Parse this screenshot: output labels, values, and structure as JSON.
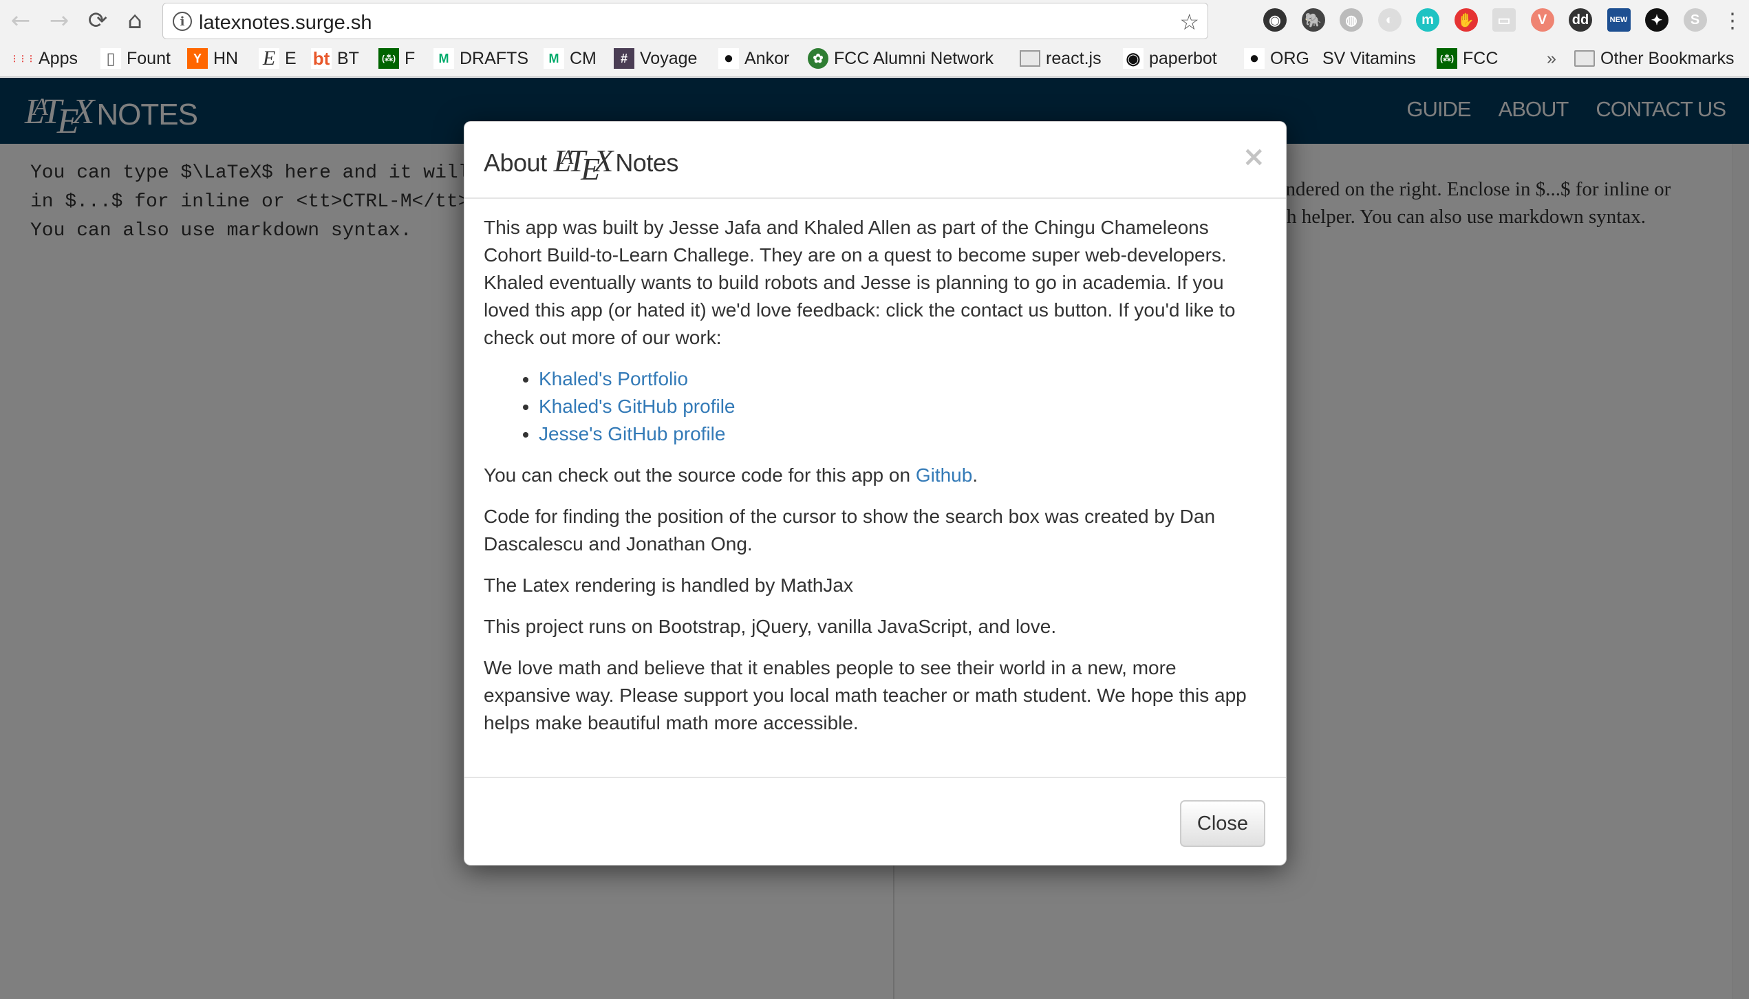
{
  "browser": {
    "nav": {
      "back_icon": "←",
      "forward_icon": "→",
      "reload_icon": "⟳",
      "home_icon": "⌂"
    },
    "address_bar": {
      "url": "latexnotes.surge.sh",
      "info_icon": "i",
      "bookmark_star_icon": "☆"
    },
    "extensions": [
      {
        "name": "camera-extension",
        "glyph": "◉",
        "color": "#333333"
      },
      {
        "name": "evernote-extension",
        "glyph": "🐘",
        "color": "#444444"
      },
      {
        "name": "globe-extension",
        "glyph": "◍",
        "color": "#bbbbbb"
      },
      {
        "name": "json-viewer-extension",
        "glyph": "◐",
        "color": "#dddddd"
      },
      {
        "name": "mercury-extension",
        "glyph": "m",
        "color": "#1ec3c3"
      },
      {
        "name": "adblock-extension",
        "glyph": "✋",
        "color": "#e53333"
      },
      {
        "name": "discover-devtools-extension",
        "glyph": "▭",
        "color": "#dddddd"
      },
      {
        "name": "vivaldi-extension",
        "glyph": "V",
        "color": "#ef8472"
      },
      {
        "name": "dd-extension",
        "glyph": "dd",
        "color": "#333333"
      },
      {
        "name": "news-extension",
        "glyph": "NEW",
        "color": "#1d4f91"
      },
      {
        "name": "ninja-extension",
        "glyph": "✦",
        "color": "#111111"
      },
      {
        "name": "skype-extension",
        "glyph": "S",
        "color": "#cccccc"
      }
    ],
    "menu_icon": "⋮",
    "bookmarks": [
      {
        "label": "Apps",
        "icon": "apps-grid-icon",
        "glyph": "⋮⋮⋮",
        "color": "#4285f4"
      },
      {
        "label": "Fount",
        "icon": "page-icon",
        "glyph": "▯",
        "color": "#ffffff"
      },
      {
        "label": "HN",
        "icon": "hacker-news-icon",
        "glyph": "Y",
        "color": "#ff6600"
      },
      {
        "label": "E",
        "icon": "e-icon",
        "glyph": "E",
        "color": "#ffffff"
      },
      {
        "label": "BT",
        "icon": "bt-icon",
        "glyph": "bt",
        "color": "#ffffff"
      },
      {
        "label": "F",
        "icon": "freecodecamp-icon",
        "glyph": "(⁂)",
        "color": "#006400"
      },
      {
        "label": "DRAFTS",
        "icon": "medium-icon",
        "glyph": "M",
        "color": "#ffffff"
      },
      {
        "label": "CM",
        "icon": "medium-icon",
        "glyph": "M",
        "color": "#ffffff"
      },
      {
        "label": "Voyage",
        "icon": "slack-icon",
        "glyph": "#",
        "color": "#4a3d54"
      },
      {
        "label": "Ankor",
        "icon": "github-icon",
        "glyph": "●",
        "color": "#ffffff"
      },
      {
        "label": "FCC Alumni Network",
        "icon": "fcc-alumni-icon",
        "glyph": "✿",
        "color": "#2e7d32"
      },
      {
        "label": "react.js",
        "icon": "folder-icon",
        "glyph": "▭",
        "color": "#ffffff"
      },
      {
        "label": "paperbot",
        "icon": "paperbot-icon",
        "glyph": "◉",
        "color": "#ffffff"
      },
      {
        "label": "ORG",
        "icon": "github-icon",
        "glyph": "●",
        "color": "#ffffff"
      },
      {
        "label": "SV Vitamins",
        "icon": "",
        "glyph": "",
        "color": "#ffffff"
      },
      {
        "label": "FCC",
        "icon": "freecodecamp-icon",
        "glyph": "(⁂)",
        "color": "#006400"
      }
    ],
    "overflow_chevron": "»",
    "other_bookmarks": "Other Bookmarks"
  },
  "app": {
    "brand": {
      "latex_L": "L",
      "latex_A": "A",
      "latex_T": "T",
      "latex_E": "E",
      "latex_X": "X",
      "suffix": "NOTES"
    },
    "nav_links": [
      "GUIDE",
      "ABOUT",
      "CONTACT US"
    ],
    "editor_text": "You can type $\\LaTeX$ here and it will be rendered on the right. Enclose in $...$ for inline or <tt>CTRL-M</tt> to bring up a LaTeX search helper. You can also use markdown syntax.",
    "editor_visible_lines": [
      "You can type $\\LaTeX$ here and it ",
      "right. Enclose in $...$ for inline",
      "<tt>CTRL-M</tt> to bring up a LaTe",
      "use markdown syntax."
    ],
    "preview_visible_lines": [
      "ndered on the right. Enclose in $...$ for inline or",
      "p a LaTeX search helper. You can also use"
    ],
    "colors": {
      "navbar": "#003a5f",
      "link": "#337ab7"
    }
  },
  "modal": {
    "title_prefix": "About",
    "title_suffix": "Notes",
    "close_x": "×",
    "paragraph_1": "This app was built by Jesse Jafa and Khaled Allen as part of the Chingu Chameleons Cohort Build-to-Learn Challege. They are on a quest to become super web-developers. Khaled eventually wants to build robots and Jesse is planning to go in academia. If you loved this app (or hated it) we'd love feedback: click the contact us button. If you'd like to check out more of our work:",
    "links": [
      "Khaled's Portfolio",
      "Khaled's GitHub profile",
      "Jesse's GitHub profile"
    ],
    "source_prefix": "You can check out the source code for this app on ",
    "source_link": "Github",
    "source_suffix": ".",
    "paragraph_cursor": "Code for finding the position of the cursor to show the search box was created by Dan Dascalescu and Jonathan Ong.",
    "paragraph_mathjax": "The Latex rendering is handled by MathJax",
    "paragraph_stack": "This project runs on Bootstrap, jQuery, vanilla JavaScript, and love.",
    "paragraph_love": "We love math and believe that it enables people to see their world in a new, more expansive way. Please support you local math teacher or math student. We hope this app helps make beautiful math more accessible.",
    "close_button": "Close"
  }
}
